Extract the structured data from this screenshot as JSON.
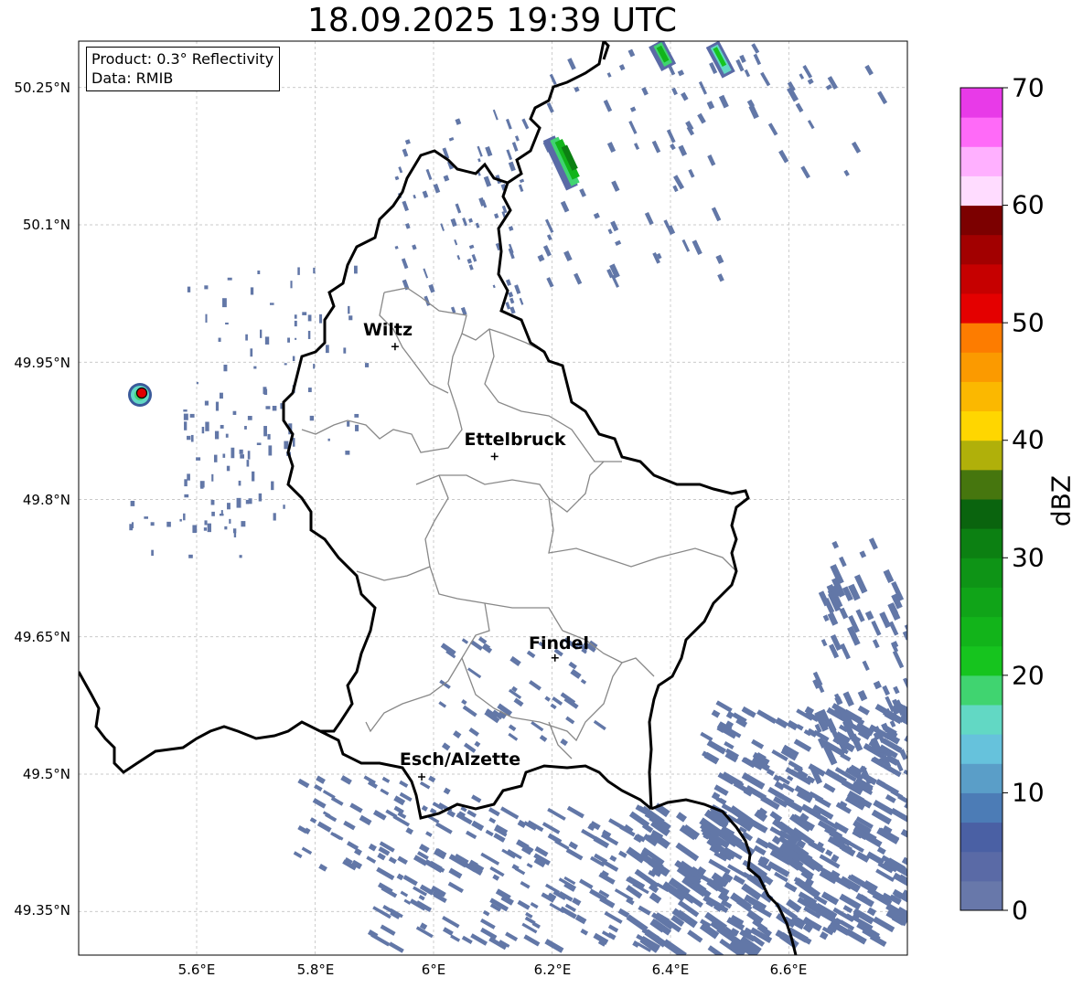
{
  "title": "18.09.2025 19:39 UTC",
  "info": {
    "product": "Product: 0.3° Reflectivity",
    "data": "Data: RMIB"
  },
  "lat_labels": [
    "50.25°N",
    "50.1°N",
    "49.95°N",
    "49.8°N",
    "49.65°N",
    "49.5°N",
    "49.35°N"
  ],
  "lon_labels": [
    "5.6°E",
    "5.8°E",
    "6°E",
    "6.2°E",
    "6.4°E",
    "6.6°E"
  ],
  "cities": [
    {
      "name": "Wiltz",
      "lon": 5.935,
      "lat": 49.967
    },
    {
      "name": "Ettelbruck",
      "lon": 6.103,
      "lat": 49.847
    },
    {
      "name": "Findel",
      "lon": 6.205,
      "lat": 49.627
    },
    {
      "name": "Esch/Alzette",
      "lon": 5.98,
      "lat": 49.497
    }
  ],
  "radar_site": {
    "lon": 5.505,
    "lat": 49.914
  },
  "colorbar": {
    "label": "dBZ",
    "ticks": [
      "0",
      "10",
      "20",
      "30",
      "40",
      "50",
      "60",
      "70"
    ],
    "min": 0,
    "max": 70,
    "step": 2.5,
    "colors": [
      "#6878aa",
      "#5a6aa6",
      "#4a60a4",
      "#4c7cb6",
      "#5a9ec8",
      "#66c2dc",
      "#62d8c4",
      "#40d470",
      "#16c41e",
      "#12b41a",
      "#10a418",
      "#0e9416",
      "#0c8012",
      "#0a640e",
      "#46760e",
      "#b0b00a",
      "#ffd600",
      "#fbb800",
      "#fb9a00",
      "#fd7c00",
      "#e40000",
      "#c60000",
      "#a20000",
      "#7c0000",
      "#ffdcff",
      "#ffb0ff",
      "#ff6af8",
      "#e83ae8"
    ]
  },
  "echo_color": "#6277a7",
  "border_color": "#000000",
  "canton_color": "#888888"
}
